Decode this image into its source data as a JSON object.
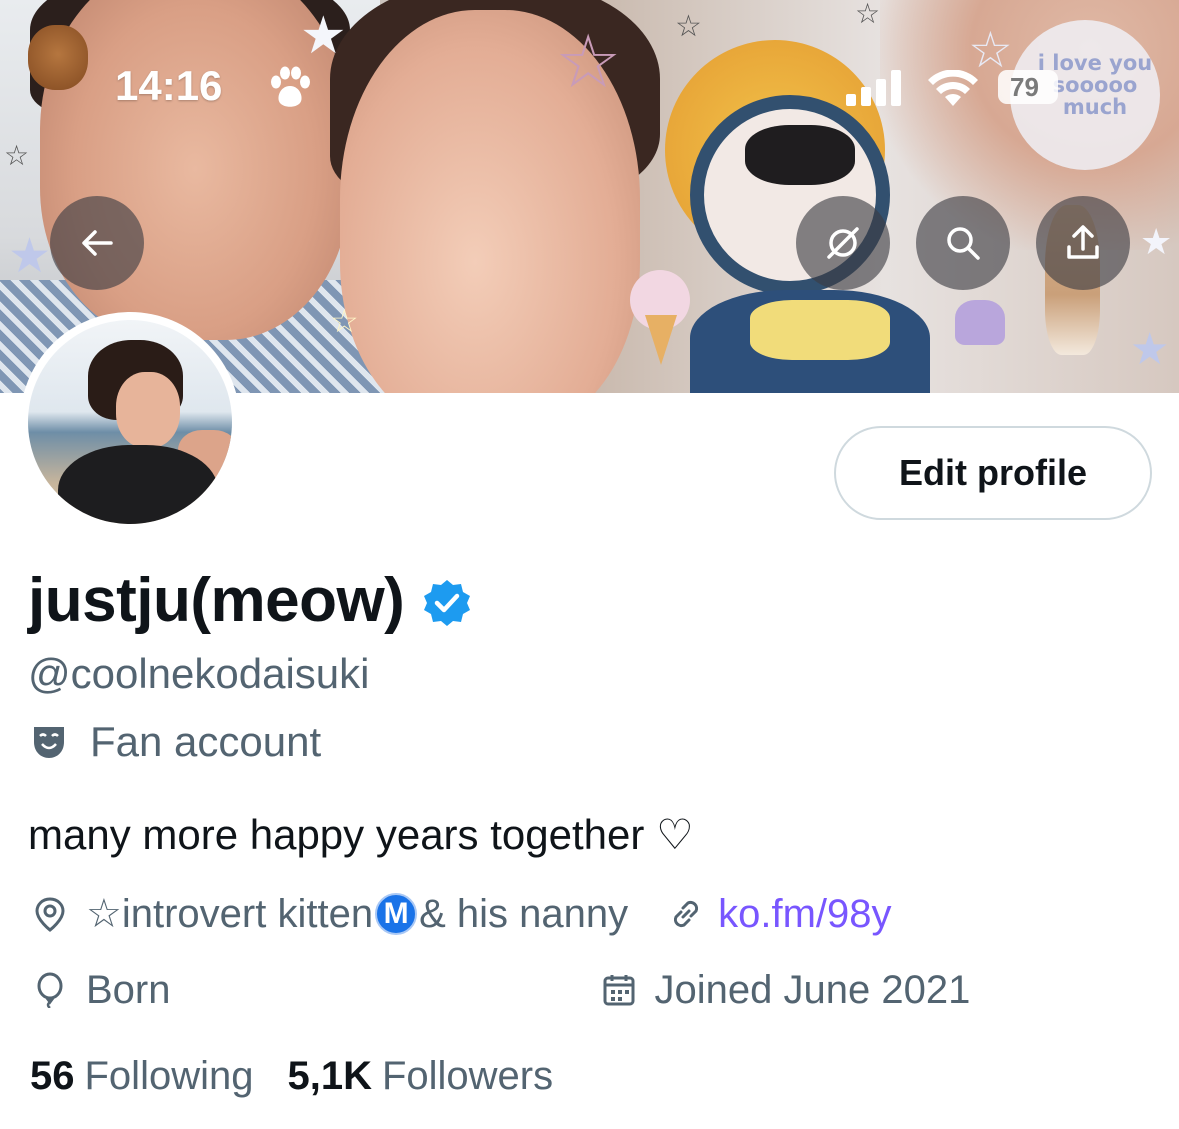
{
  "status_bar": {
    "time": "14:16",
    "battery": "79",
    "icons": [
      "paw-icon",
      "signal-icon",
      "wifi-icon",
      "battery-icon"
    ]
  },
  "banner": {
    "sticker_text": "i love you sooooo much"
  },
  "header_buttons": {
    "back": "arrow-left-icon",
    "translate": "no-translate-icon",
    "search": "search-icon",
    "share": "share-icon"
  },
  "edit_profile_label": "Edit profile",
  "profile": {
    "display_name": "justju(meow)",
    "handle": "@coolnekodaisuki",
    "category": "Fan account",
    "bio": "many more happy years together ♡",
    "location_pre": "☆introvert kitten",
    "location_badge": "M",
    "location_post": "& his nanny",
    "link": "ko.fm/98y",
    "born": "Born",
    "joined": "Joined June 2021",
    "following_count": "56",
    "following_label": "Following",
    "followers_count": "5,1K",
    "followers_label": "Followers"
  },
  "colors": {
    "text_primary": "#0f1419",
    "text_secondary": "#536471",
    "link": "#7856ff",
    "verified": "#1d9bf0",
    "button_border": "#cfd9de"
  }
}
